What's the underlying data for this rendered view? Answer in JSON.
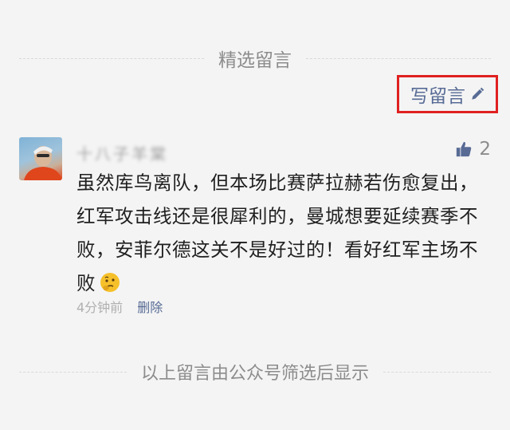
{
  "header": {
    "title": "精选留言"
  },
  "actions": {
    "write_comment_label": "写留言",
    "write_comment_icon": "pencil-icon",
    "highlight_color": "#e02020",
    "link_color": "#576b95"
  },
  "comment": {
    "avatar_icon": "avatar",
    "nickname": "十八子羊棠",
    "likes": "2",
    "like_icon": "thumbs-up-icon",
    "text": "虽然库鸟离队，但本场比赛萨拉赫若伤愈复出，红军攻击线还是很犀利的，曼城想要延续赛季不败，安菲尔德这关不是好过的！看好红军主场不败",
    "emoji_icon": "thinking-face-emoji",
    "time": "4分钟前",
    "delete_label": "删除"
  },
  "footer": {
    "note": "以上留言由公众号筛选后显示"
  }
}
